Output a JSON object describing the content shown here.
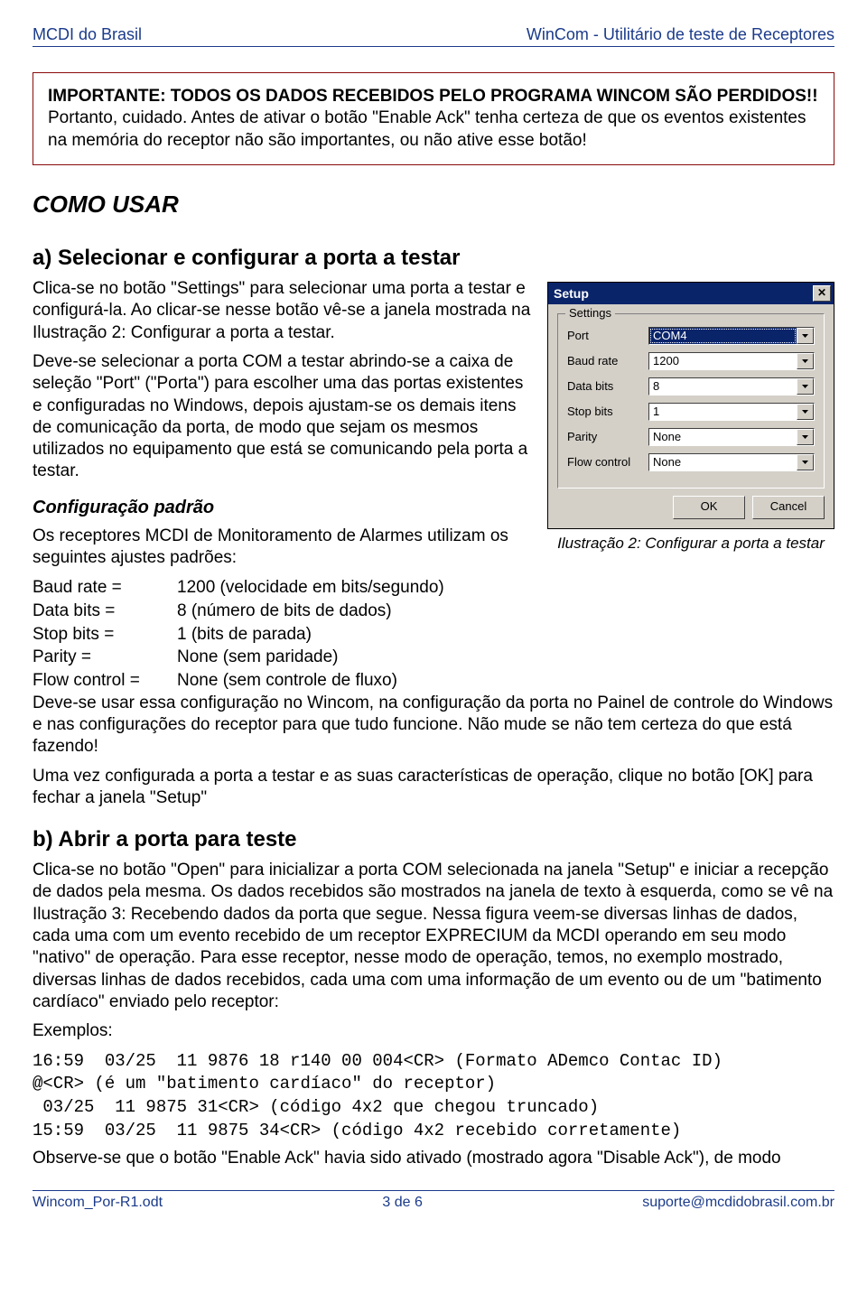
{
  "header": {
    "left": "MCDI do Brasil",
    "right": "WinCom - Utilitário de teste de Receptores"
  },
  "warning": {
    "bold": "IMPORTANTE: TODOS OS DADOS RECEBIDOS PELO PROGRAMA WINCOM SÃO PERDIDOS!!",
    "rest": " Portanto, cuidado. Antes de ativar o botão \"Enable Ack\" tenha certeza de que os eventos existentes na memória do receptor não são importantes, ou não ative esse botão!"
  },
  "como_usar": "COMO USAR",
  "sec_a": {
    "title": "a) Selecionar e configurar a porta a testar",
    "p1": "Clica-se no botão \"Settings\" para selecionar uma porta a testar e configurá-la. Ao clicar-se nesse botão vê-se a janela mostrada na Ilustração 2: Configurar a porta a testar.",
    "p2": "Deve-se selecionar a porta COM a testar abrindo-se a caixa de seleção \"Port\" (\"Porta\") para escolher uma das portas existentes e configuradas no Windows, depois ajustam-se os demais itens de comunicação da porta, de modo que sejam os mesmos utilizados no equipamento que está se comunicando pela porta a testar."
  },
  "config_padrao": {
    "title": "Configuração padrão",
    "p1": "Os receptores MCDI de Monitoramento de Alarmes utilizam os seguintes ajustes padrões:",
    "rows": [
      {
        "k": "Baud rate =",
        "v": "1200 (velocidade em bits/segundo)"
      },
      {
        "k": "Data bits =",
        "v": "8 (número de bits de dados)"
      },
      {
        "k": "Stop bits =",
        "v": "1 (bits de parada)"
      },
      {
        "k": "Parity =",
        "v": "None (sem paridade)"
      },
      {
        "k": "Flow control =",
        "v": "None (sem controle de fluxo)"
      }
    ],
    "p2": "Deve-se usar essa configuração no Wincom, na configuração da porta no Painel de controle do Windows e nas configurações do receptor para que tudo funcione. Não mude se não tem certeza do que está fazendo!",
    "p3": "Uma vez configurada a porta a testar e as suas características de operação, clique no botão [OK] para fechar a janela \"Setup\""
  },
  "setup_dialog": {
    "title": "Setup",
    "group_label": "Settings",
    "fields": {
      "port": {
        "label": "Port",
        "value": "COM4"
      },
      "baud": {
        "label": "Baud rate",
        "value": "1200"
      },
      "databits": {
        "label": "Data bits",
        "value": "8"
      },
      "stopbits": {
        "label": "Stop bits",
        "value": "1"
      },
      "parity": {
        "label": "Parity",
        "value": "None"
      },
      "flowcontrol": {
        "label": "Flow control",
        "value": "None"
      }
    },
    "ok": "OK",
    "cancel": "Cancel",
    "close_glyph": "✕",
    "caption": "Ilustração 2: Configurar a porta a testar"
  },
  "sec_b": {
    "title": "b) Abrir a porta para teste",
    "p1": "Clica-se no botão \"Open\" para inicializar a porta COM selecionada na janela \"Setup\" e iniciar a recepção de dados pela mesma. Os dados recebidos são mostrados na janela de texto à esquerda, como se vê na Ilustração 3: Recebendo dados da porta que segue. Nessa figura veem-se diversas linhas de dados, cada uma com um evento recebido de um receptor EXPRECIUM da MCDI operando em seu modo \"nativo\" de operação. Para esse receptor, nesse modo de operação, temos, no exemplo mostrado, diversas linhas de dados recebidos, cada uma com uma informação de um evento ou de um \"batimento cardíaco\" enviado pelo receptor:",
    "ex_label": "Exemplos:",
    "ex1": "16:59  03/25  11 9876 18 r140 00 004<CR> (Formato ADemco Contac ID)",
    "ex2": "@<CR> (é um \"batimento cardíaco\" do receptor)",
    "ex3": " 03/25  11 9875 31<CR> (código 4x2 que chegou truncado)",
    "ex4": "15:59  03/25  11 9875 34<CR> (código 4x2 recebido corretamente)",
    "p2": "Observe-se que o botão \"Enable Ack\" havia sido ativado (mostrado agora \"Disable Ack\"), de modo"
  },
  "footer": {
    "left": "Wincom_Por-R1.odt",
    "center": "3 de 6",
    "right": "suporte@mcdidobrasil.com.br"
  }
}
